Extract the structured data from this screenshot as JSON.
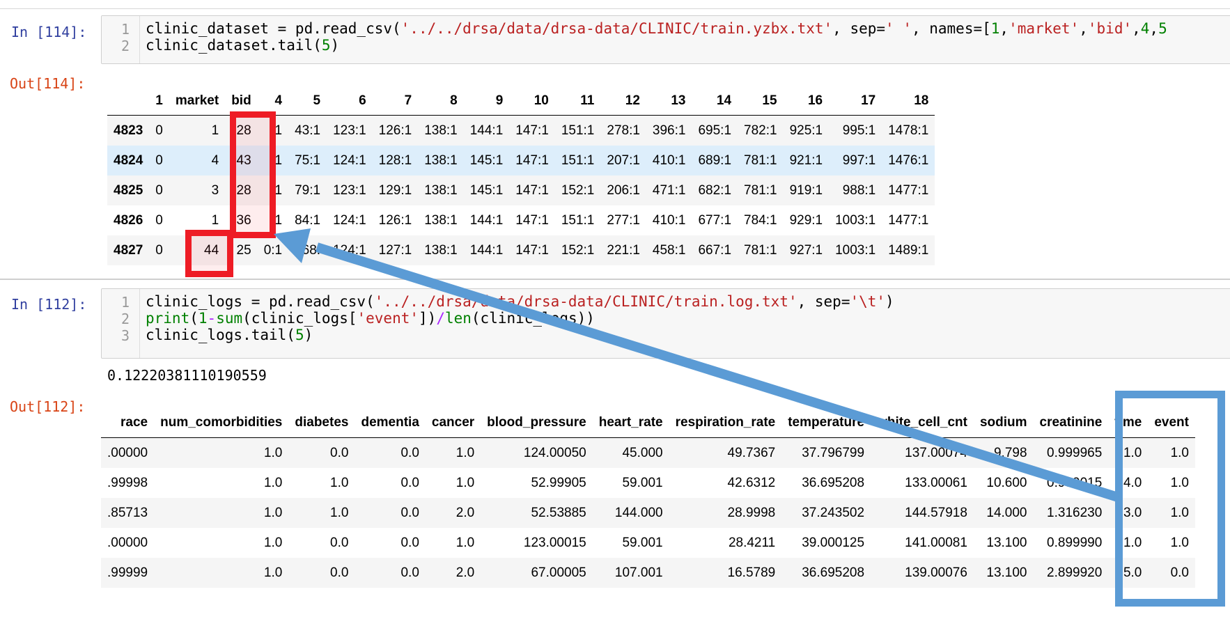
{
  "cells": [
    {
      "in_prompt": "In [114]:",
      "out_prompt": "Out[114]:",
      "code_lines": [
        [
          [
            "clinic_dataset = pd.read_csv(",
            ""
          ],
          [
            "'../../drsa/data/drsa-data/CLINIC/train.yzbx.txt'",
            "s"
          ],
          [
            ", sep=",
            ""
          ],
          [
            "' '",
            "s"
          ],
          [
            ", names=[",
            ""
          ],
          [
            "1",
            "n"
          ],
          [
            ",",
            ""
          ],
          [
            "'market'",
            "s"
          ],
          [
            ",",
            ""
          ],
          [
            "'bid'",
            "s"
          ],
          [
            ",",
            ""
          ],
          [
            "4",
            "n"
          ],
          [
            ",",
            ""
          ],
          [
            "5",
            "n"
          ]
        ],
        [
          [
            "clinic_dataset.tail(",
            ""
          ],
          [
            "5",
            "n"
          ],
          [
            ")",
            ""
          ]
        ]
      ],
      "table": {
        "columns": [
          "",
          "1",
          "market",
          "bid",
          "4",
          "5",
          "6",
          "7",
          "8",
          "9",
          "10",
          "11",
          "12",
          "13",
          "14",
          "15",
          "16",
          "17",
          "18"
        ],
        "rows": [
          [
            "4823",
            "0",
            "1",
            "28",
            ":1",
            "43:1",
            "123:1",
            "126:1",
            "138:1",
            "144:1",
            "147:1",
            "151:1",
            "278:1",
            "396:1",
            "695:1",
            "782:1",
            "925:1",
            "995:1",
            "1478:1"
          ],
          [
            "4824",
            "0",
            "4",
            "43",
            ":1",
            "75:1",
            "124:1",
            "128:1",
            "138:1",
            "145:1",
            "147:1",
            "151:1",
            "207:1",
            "410:1",
            "689:1",
            "781:1",
            "921:1",
            "997:1",
            "1476:1"
          ],
          [
            "4825",
            "0",
            "3",
            "28",
            ":1",
            "79:1",
            "123:1",
            "129:1",
            "138:1",
            "145:1",
            "147:1",
            "152:1",
            "206:1",
            "471:1",
            "682:1",
            "781:1",
            "919:1",
            "988:1",
            "1477:1"
          ],
          [
            "4826",
            "0",
            "1",
            "36",
            ":1",
            "84:1",
            "124:1",
            "126:1",
            "138:1",
            "144:1",
            "147:1",
            "151:1",
            "277:1",
            "410:1",
            "677:1",
            "784:1",
            "929:1",
            "1003:1",
            "1477:1"
          ],
          [
            "4827",
            "0",
            "44",
            "25",
            "0:1",
            "68:",
            "124:1",
            "127:1",
            "138:1",
            "144:1",
            "147:1",
            "152:1",
            "221:1",
            "458:1",
            "667:1",
            "781:1",
            "927:1",
            "1003:1",
            "1489:1"
          ]
        ]
      }
    },
    {
      "in_prompt": "In [112]:",
      "out_prompt": "Out[112]:",
      "code_lines": [
        [
          [
            "clinic_logs = pd.read_csv(",
            ""
          ],
          [
            "'../../drsa/data/drsa-data/CLINIC/train.log.txt'",
            "s"
          ],
          [
            ", sep=",
            ""
          ],
          [
            "'\\t'",
            "s"
          ],
          [
            ")",
            ""
          ]
        ],
        [
          [
            "print",
            "k"
          ],
          [
            "(",
            ""
          ],
          [
            "1",
            "n"
          ],
          [
            "-",
            "o"
          ],
          [
            "sum",
            "k"
          ],
          [
            "(clinic_logs[",
            ""
          ],
          [
            "'event'",
            "s"
          ],
          [
            "])",
            ""
          ],
          [
            "/",
            "o"
          ],
          [
            "len",
            "k"
          ],
          [
            "(clinic_logs))",
            ""
          ]
        ],
        [
          [
            "clinic_logs.tail(",
            ""
          ],
          [
            "5",
            "n"
          ],
          [
            ")",
            ""
          ]
        ]
      ],
      "stdout": "0.12220381110190559",
      "table": {
        "columns": [
          "race",
          "num_comorbidities",
          "diabetes",
          "dementia",
          "cancer",
          "blood_pressure",
          "heart_rate",
          "respiration_rate",
          "temperature",
          "white_cell_cnt",
          "sodium",
          "creatinine",
          "time",
          "event"
        ],
        "rows": [
          [
            ".00000",
            "1.0",
            "0.0",
            "0.0",
            "1.0",
            "124.00050",
            "45.000",
            "49.7367",
            "37.796799",
            "137.00074",
            "9.798",
            "0.999965",
            "1.0",
            "1.0"
          ],
          [
            ".99998",
            "1.0",
            "1.0",
            "0.0",
            "1.0",
            "52.99905",
            "59.001",
            "42.6312",
            "36.695208",
            "133.00061",
            "10.600",
            "0.999015",
            "4.0",
            "1.0"
          ],
          [
            ".85713",
            "1.0",
            "1.0",
            "0.0",
            "2.0",
            "52.53885",
            "144.000",
            "28.9998",
            "37.243502",
            "144.57918",
            "14.000",
            "1.316230",
            "3.0",
            "1.0"
          ],
          [
            ".00000",
            "1.0",
            "0.0",
            "0.0",
            "1.0",
            "123.00015",
            "59.001",
            "28.4211",
            "39.000125",
            "141.00081",
            "13.100",
            "0.899990",
            "1.0",
            "1.0"
          ],
          [
            ".99999",
            "1.0",
            "0.0",
            "0.0",
            "2.0",
            "67.00005",
            "107.001",
            "16.5789",
            "36.695208",
            "139.00076",
            "13.100",
            "2.899920",
            "25.0",
            "0.0"
          ]
        ]
      }
    }
  ],
  "colors": {
    "red_annotation": "#ee1c25",
    "blue_annotation": "#5b9bd5",
    "highlight_row": "#ddeefb"
  }
}
